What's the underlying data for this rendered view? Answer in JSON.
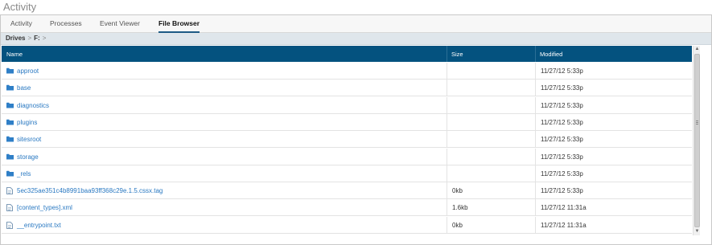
{
  "app": {
    "title": "Activity"
  },
  "tabs": [
    {
      "label": "Activity",
      "active": false
    },
    {
      "label": "Processes",
      "active": false
    },
    {
      "label": "Event Viewer",
      "active": false
    },
    {
      "label": "File Browser",
      "active": true
    }
  ],
  "breadcrumb": {
    "root": "Drives",
    "current": "F:",
    "separator": ">"
  },
  "table": {
    "columns": {
      "name": "Name",
      "size": "Size",
      "modified": "Modified"
    },
    "rows": [
      {
        "type": "folder",
        "name": "approot",
        "size": "",
        "modified": "11/27/12 5:33p"
      },
      {
        "type": "folder",
        "name": "base",
        "size": "",
        "modified": "11/27/12 5:33p"
      },
      {
        "type": "folder",
        "name": "diagnostics",
        "size": "",
        "modified": "11/27/12 5:33p"
      },
      {
        "type": "folder",
        "name": "plugins",
        "size": "",
        "modified": "11/27/12 5:33p"
      },
      {
        "type": "folder",
        "name": "sitesroot",
        "size": "",
        "modified": "11/27/12 5:33p"
      },
      {
        "type": "folder",
        "name": "storage",
        "size": "",
        "modified": "11/27/12 5:33p"
      },
      {
        "type": "folder",
        "name": "_rels",
        "size": "",
        "modified": "11/27/12 5:33p"
      },
      {
        "type": "file",
        "name": "5ec325ae351c4b8991baa93ff368c29e.1.5.cssx.tag",
        "size": "0kb",
        "modified": "11/27/12 5:33p"
      },
      {
        "type": "file",
        "name": "[content_types].xml",
        "size": "1.6kb",
        "modified": "11/27/12 11:31a"
      },
      {
        "type": "file",
        "name": "__entrypoint.txt",
        "size": "0kb",
        "modified": "11/27/12 11:31a"
      }
    ]
  },
  "colors": {
    "header_bg": "#04527f",
    "link": "#2a79c2",
    "folder_icon": "#2f7fc7",
    "breadcrumb_bg": "#dfe6eb"
  },
  "icons": {
    "folder": "folder-icon",
    "file": "file-icon"
  }
}
